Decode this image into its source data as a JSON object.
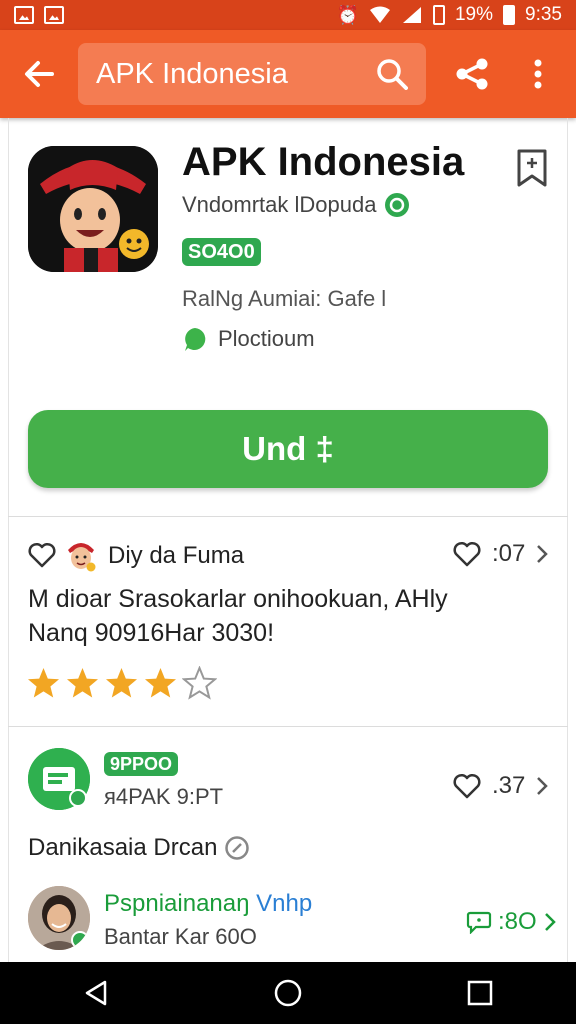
{
  "status_bar": {
    "battery_text": "19%",
    "time": "9:35"
  },
  "app_bar": {
    "search_text": "APK Indonesia"
  },
  "app": {
    "title": "APK Indonesia",
    "developer": "Vndomrtak lDopuda",
    "badge": "SO4O0",
    "rating_line": "RalNg Aumiai: Gafe l",
    "category": "Ploctioum",
    "install_label": "Und ‡"
  },
  "review": {
    "reviewer_name": "Diy da Fuma",
    "likes": ":07",
    "text_line1": "M dioar Srasokarlar onihookuan, AHly",
    "text_line2": "Nanq 90916Har 3030!",
    "rating": 4,
    "rating_max": 5
  },
  "item": {
    "badge": "9PPOO",
    "subtitle": "ᴙ4PAK 9:PT",
    "likes": ".37"
  },
  "section": {
    "label": "Danikasaia Drcan"
  },
  "person": {
    "name_green": "Pspniainanaŋ",
    "name_blue": "Vnhp",
    "subtitle": "Bantar Kar 60O",
    "count": ":8O"
  },
  "colors": {
    "status_bar": "#d8431a",
    "app_bar": "#ef5a26",
    "install_button": "#45b04a",
    "badge_green": "#2fa84f",
    "star": "#f2a623"
  }
}
